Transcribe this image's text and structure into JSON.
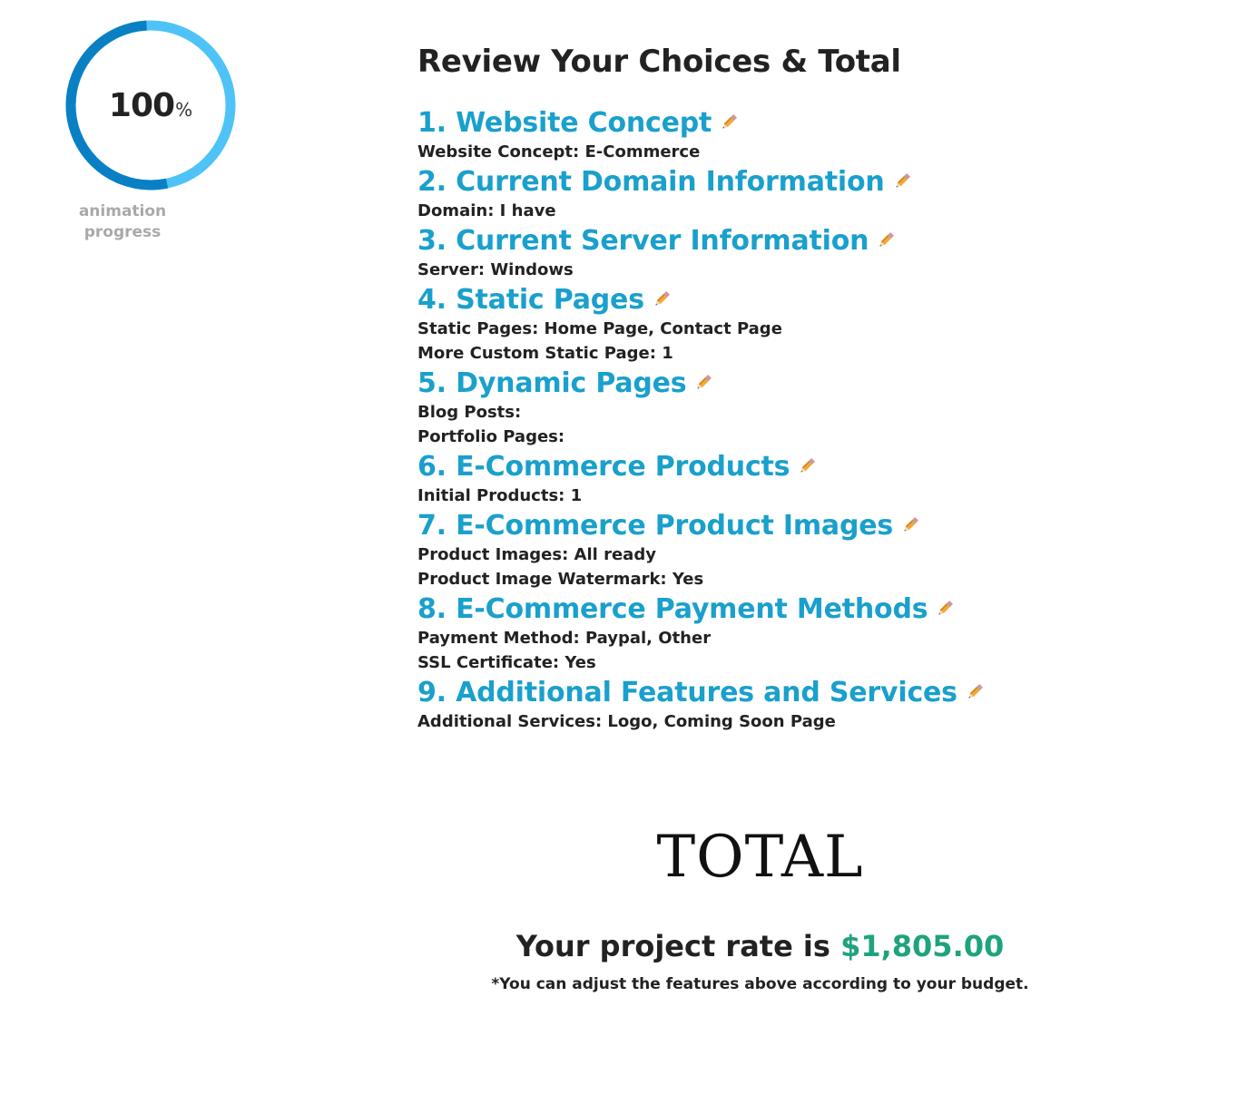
{
  "progress": {
    "value": "100",
    "unit": "%",
    "caption_line1": "animation",
    "caption_line2": "progress",
    "percent": 100,
    "colors": {
      "light": "#4fc3f7",
      "dark": "#0a80c4"
    }
  },
  "review": {
    "title": "Review Your Choices & Total",
    "steps": [
      {
        "title": "1. Website Concept",
        "details": [
          "Website Concept: E-Commerce"
        ]
      },
      {
        "title": "2. Current Domain Information",
        "details": [
          "Domain: I have"
        ]
      },
      {
        "title": "3. Current Server Information",
        "details": [
          "Server: Windows"
        ]
      },
      {
        "title": "4. Static Pages",
        "details": [
          "Static Pages: Home Page, Contact Page",
          "More Custom Static Page: 1"
        ]
      },
      {
        "title": "5. Dynamic Pages",
        "details": [
          "Blog Posts:",
          "Portfolio Pages:"
        ]
      },
      {
        "title": "6. E-Commerce Products",
        "details": [
          "Initial Products: 1"
        ]
      },
      {
        "title": "7. E-Commerce Product Images",
        "details": [
          "Product Images: All ready",
          "Product Image Watermark: Yes"
        ]
      },
      {
        "title": "8. E-Commerce Payment Methods",
        "details": [
          "Payment Method: Paypal, Other",
          "SSL Certificate: Yes"
        ]
      },
      {
        "title": "9. Additional Features and Services",
        "details": [
          "Additional Services: Logo, Coming Soon Page"
        ]
      }
    ],
    "edit_icon": "pencil-icon",
    "accent_color": "#1aa0cc"
  },
  "total": {
    "heading": "TOTAL",
    "rate_prefix": "Your project rate is ",
    "rate_amount": "$1,805.00",
    "note": "*You can adjust the features above according to your budget.",
    "amount_color": "#1fa37f"
  }
}
